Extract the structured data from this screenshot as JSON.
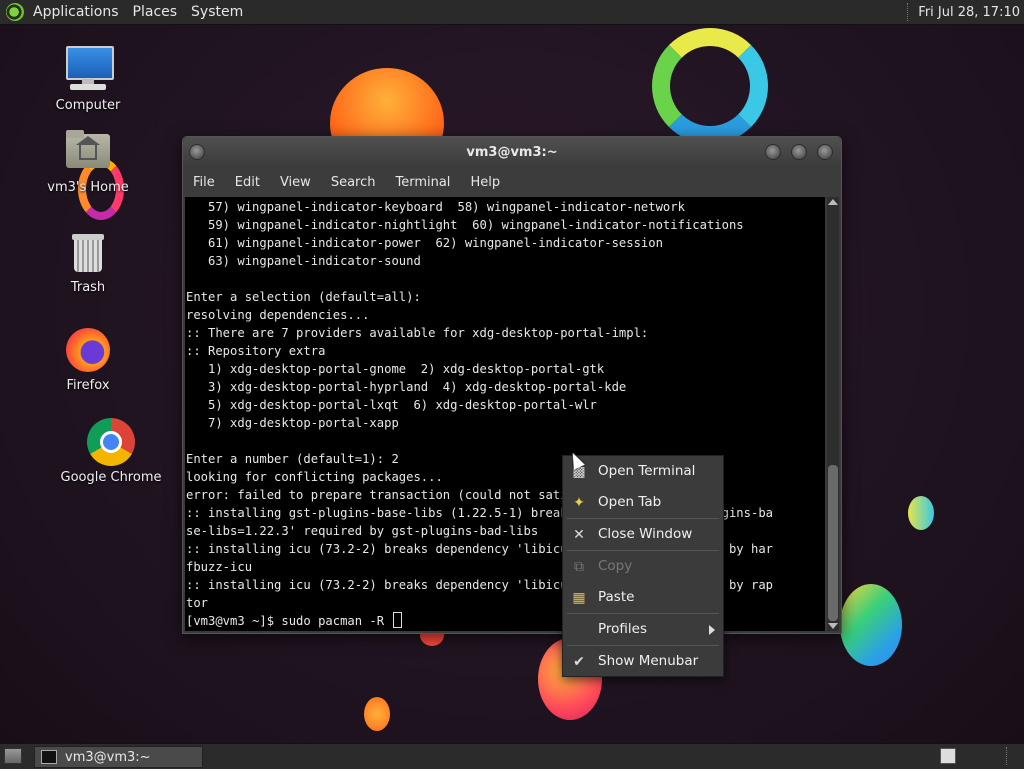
{
  "top_panel": {
    "menus": [
      "Applications",
      "Places",
      "System"
    ],
    "clock": "Fri Jul 28, 17:10"
  },
  "desktop_icons": [
    {
      "label": "Computer",
      "icon": "computer-icon"
    },
    {
      "label": "vm3's Home",
      "icon": "home-folder-icon"
    },
    {
      "label": "Trash",
      "icon": "trash-icon"
    },
    {
      "label": "Firefox",
      "icon": "firefox-icon"
    },
    {
      "label": "Google Chrome",
      "icon": "chrome-icon"
    }
  ],
  "terminal": {
    "title": "vm3@vm3:~",
    "menubar": [
      "File",
      "Edit",
      "View",
      "Search",
      "Terminal",
      "Help"
    ],
    "lines": [
      "   57) wingpanel-indicator-keyboard  58) wingpanel-indicator-network",
      "   59) wingpanel-indicator-nightlight  60) wingpanel-indicator-notifications",
      "   61) wingpanel-indicator-power  62) wingpanel-indicator-session",
      "   63) wingpanel-indicator-sound",
      "",
      "Enter a selection (default=all):",
      "resolving dependencies...",
      ":: There are 7 providers available for xdg-desktop-portal-impl:",
      ":: Repository extra",
      "   1) xdg-desktop-portal-gnome  2) xdg-desktop-portal-gtk",
      "   3) xdg-desktop-portal-hyprland  4) xdg-desktop-portal-kde",
      "   5) xdg-desktop-portal-lxqt  6) xdg-desktop-portal-wlr",
      "   7) xdg-desktop-portal-xapp",
      "",
      "Enter a number (default=1): 2",
      "looking for conflicting packages...",
      "error: failed to prepare transaction (could not satisfy dependencies)",
      ":: installing gst-plugins-base-libs (1.22.5-1) breaks dependency 'gst-plugins-ba",
      "se-libs=1.22.3' required by gst-plugins-bad-libs",
      ":: installing icu (73.2-2) breaks dependency 'libicuuc.so=72-64' required by har",
      "fbuzz-icu",
      ":: installing icu (73.2-2) breaks dependency 'libicuuc.so=72-64' required by rap",
      "tor"
    ],
    "prompt": "[vm3@vm3 ~]$ sudo pacman -R "
  },
  "context_menu": {
    "items": [
      {
        "label": "Open Terminal",
        "icon": "terminal-icon",
        "enabled": true
      },
      {
        "label": "Open Tab",
        "icon": "new-tab-icon",
        "enabled": true
      },
      {
        "label": "Close Window",
        "icon": "close-icon",
        "enabled": true
      },
      {
        "label": "Copy",
        "icon": "copy-icon",
        "enabled": false
      },
      {
        "label": "Paste",
        "icon": "paste-icon",
        "enabled": true
      },
      {
        "label": "Profiles",
        "icon": "submenu-arrow",
        "enabled": true
      },
      {
        "label": "Show Menubar",
        "icon": "checkmark-icon",
        "enabled": true,
        "checked": true
      }
    ]
  },
  "bottom_panel": {
    "task_label": "vm3@vm3:~"
  }
}
